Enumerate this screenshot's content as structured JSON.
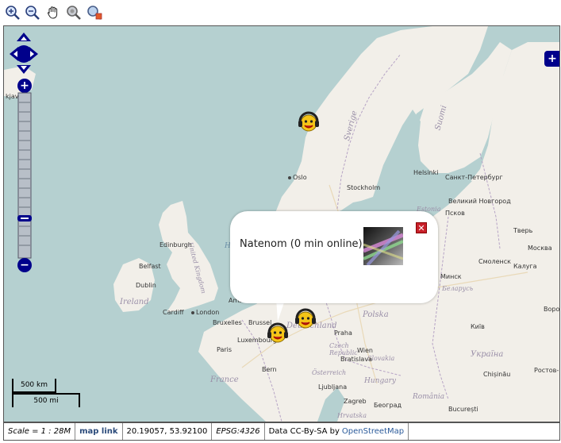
{
  "toolbar": {
    "tools": [
      "zoom-in-icon",
      "zoom-out-icon",
      "pan-hand-icon",
      "zoom-extent-icon",
      "zoom-box-icon"
    ]
  },
  "colors": {
    "sea": "#b5d0d0",
    "land": "#f2efe9",
    "nav_blue": "#00008b",
    "close_red": "#c8202a"
  },
  "map": {
    "cities": [
      {
        "name": "Oslo"
      },
      {
        "name": "Stockholm"
      },
      {
        "name": "Helsinki"
      },
      {
        "name": "Санкт-Петербург"
      },
      {
        "name": "Великий Новгород"
      },
      {
        "name": "Псков"
      },
      {
        "name": "Тверь"
      },
      {
        "name": "Москва"
      },
      {
        "name": "Смоленск"
      },
      {
        "name": "Калуга"
      },
      {
        "name": "Минск"
      },
      {
        "name": "Edinburgh"
      },
      {
        "name": "Belfast"
      },
      {
        "name": "Dublin"
      },
      {
        "name": "Cardiff"
      },
      {
        "name": "London"
      },
      {
        "name": "Ams"
      },
      {
        "name": "Bruxelles"
      },
      {
        "name": "Brussel"
      },
      {
        "name": "Luxembourg"
      },
      {
        "name": "Paris"
      },
      {
        "name": "Bern"
      },
      {
        "name": "Praha"
      },
      {
        "name": "Bratislava"
      },
      {
        "name": "Wien"
      },
      {
        "name": "Київ"
      },
      {
        "name": "Chișinău"
      },
      {
        "name": "Ростов-"
      },
      {
        "name": "Ljubljana"
      },
      {
        "name": "Zagreb"
      },
      {
        "name": "Београд"
      },
      {
        "name": "București"
      },
      {
        "name": "Воро"
      },
      {
        "name": "kjavík"
      }
    ],
    "regions": [
      "Sverige",
      "Suomi",
      "Estonia",
      "Ireland",
      "United Kingdom",
      "France",
      "Deutschland",
      "Polska",
      "Czech Republic",
      "Slovakia",
      "Österreich",
      "Hungary",
      "România",
      "Україна",
      "Беларусь",
      "Hrvatska",
      "Но"
    ]
  },
  "popup": {
    "text": "Natenom (0 min online)",
    "close_glyph": "✕"
  },
  "controls": {
    "pan": [
      "pan-up-icon",
      "pan-left-icon",
      "pan-right-icon",
      "pan-down-icon"
    ],
    "zoom_in": "+",
    "zoom_out": "−",
    "overview": "+"
  },
  "scale": {
    "km": "500 km",
    "mi": "500 mi"
  },
  "statusbar": {
    "scale": "Scale = 1 : 28M",
    "map_link": "map link",
    "coords": "20.19057, 53.92100",
    "epsg": "EPSG:4326",
    "attribution": "Data CC-By-SA by",
    "osm": "OpenStreetMap"
  }
}
